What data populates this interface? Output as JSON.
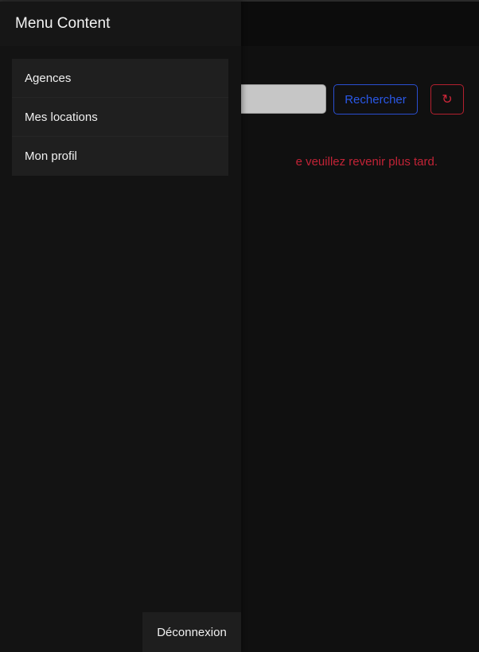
{
  "menu": {
    "title": "Menu Content",
    "items": [
      {
        "label": "Agences"
      },
      {
        "label": "Mes locations"
      },
      {
        "label": "Mon profil"
      }
    ],
    "logout_label": "Déconnexion"
  },
  "search": {
    "value": "",
    "button_label": "Rechercher",
    "refresh_icon": "↻"
  },
  "error": {
    "visible_text": "e veuillez revenir plus tard."
  },
  "colors": {
    "search_button": "#2a58e8",
    "error": "#c22336",
    "refresh_button": "#d0273a"
  }
}
